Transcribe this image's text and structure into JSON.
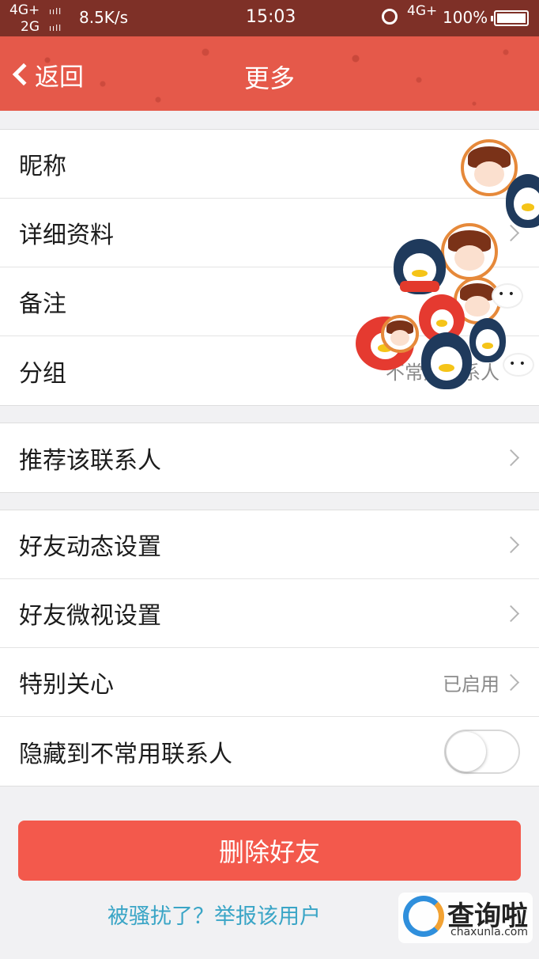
{
  "status_bar": {
    "net_top": "4G+",
    "net_bottom": "2G",
    "signal": "ııll",
    "speed": "8.5K/s",
    "time": "15:03",
    "net_right": "4G+",
    "battery_pct": "100%"
  },
  "nav": {
    "back_label": "返回",
    "title": "更多"
  },
  "group1": {
    "items": [
      {
        "label": "昵称"
      },
      {
        "label": "详细资料"
      },
      {
        "label": "备注"
      },
      {
        "label": "分组",
        "value": "不常用联系人"
      }
    ]
  },
  "group2": {
    "items": [
      {
        "label": "推荐该联系人"
      }
    ]
  },
  "group3": {
    "items": [
      {
        "label": "好友动态设置"
      },
      {
        "label": "好友微视设置"
      },
      {
        "label": "特别关心",
        "value": "已启用"
      },
      {
        "label": "隐藏到不常用联系人",
        "toggle_on": false
      }
    ]
  },
  "delete_label": "删除好友",
  "report_link": "被骚扰了？举报该用户",
  "watermark": {
    "main": "查询啦",
    "sub": "chaxunla.com"
  },
  "colors": {
    "nav": "#e5594a",
    "status_bar": "#7e3027",
    "delete": "#f3594c",
    "link": "#3aa5c6"
  }
}
